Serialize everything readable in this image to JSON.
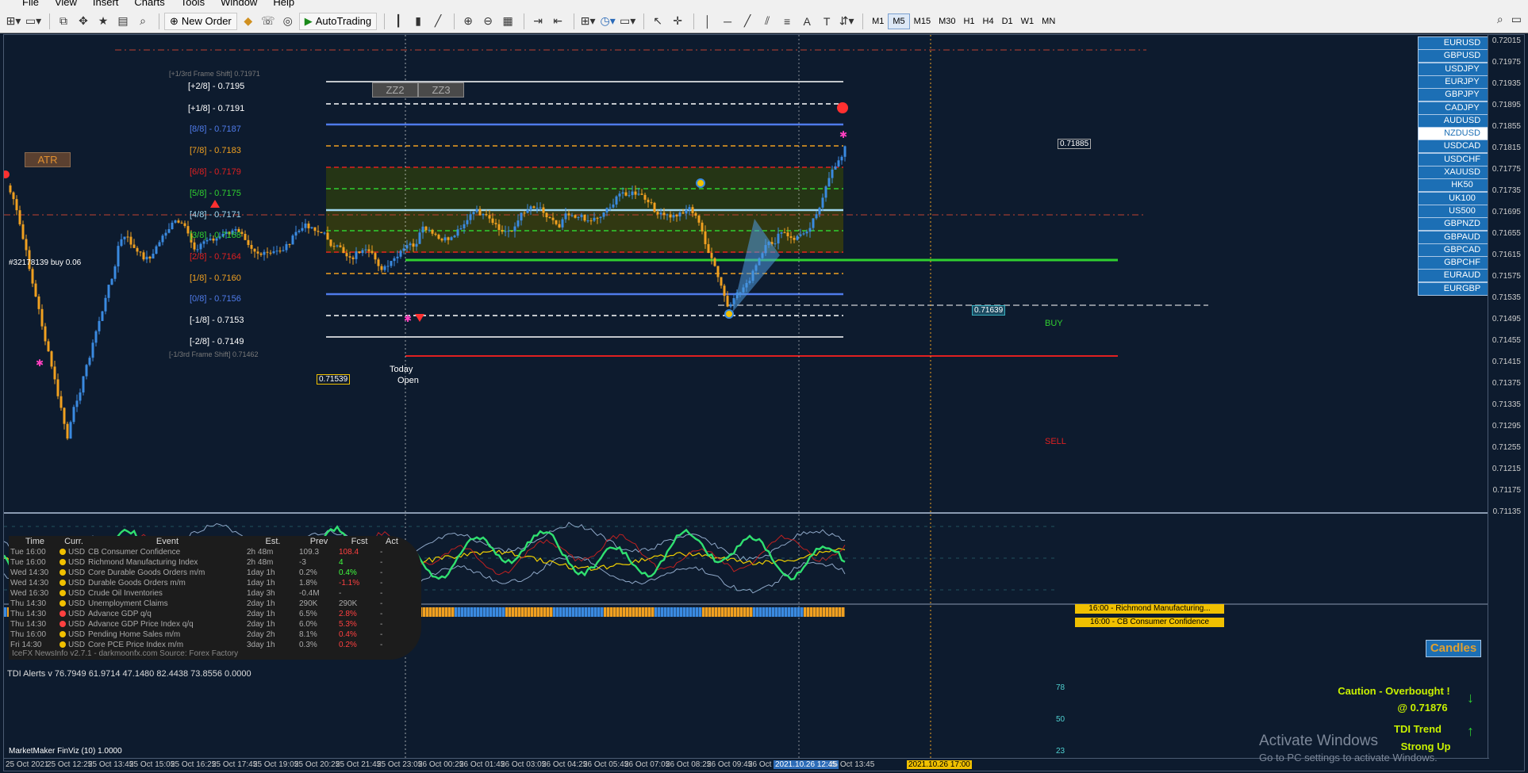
{
  "menu": [
    "File",
    "View",
    "Insert",
    "Charts",
    "Tools",
    "Window",
    "Help"
  ],
  "toolbar": {
    "new_order": "New Order",
    "auto_trading": "AutoTrading",
    "timeframes": [
      "M1",
      "M5",
      "M15",
      "M30",
      "H1",
      "H4",
      "D1",
      "W1",
      "MN"
    ],
    "active_timeframe": "M5"
  },
  "chart": {
    "zz_buttons": [
      "ZZ2",
      "ZZ3"
    ],
    "atr_button": "ATR",
    "murray_levels": [
      {
        "label": "[+1/3rd Frame Shift]  0.71971",
        "color": "#7a7a7a"
      },
      {
        "label": "[+2/8] - 0.7195",
        "color": "#ffffff"
      },
      {
        "label": "[+1/8] - 0.7191",
        "color": "#ffffff"
      },
      {
        "label": "[8/8] - 0.7187",
        "color": "#4f7bea"
      },
      {
        "label": "[7/8] - 0.7183",
        "color": "#f0a020"
      },
      {
        "label": "[6/8] - 0.7179",
        "color": "#e02020"
      },
      {
        "label": "[5/8] - 0.7175",
        "color": "#30d030"
      },
      {
        "label": "[4/8] - 0.7171",
        "color": "#a0d8f0"
      },
      {
        "label": "[3/8] - 0.7168",
        "color": "#30d030"
      },
      {
        "label": "[2/8] - 0.7164",
        "color": "#e02020"
      },
      {
        "label": "[1/8] - 0.7160",
        "color": "#f0a020"
      },
      {
        "label": "[0/8] - 0.7156",
        "color": "#4f7bea"
      },
      {
        "label": "[-1/8] - 0.7153",
        "color": "#ffffff"
      },
      {
        "label": "[-2/8] - 0.7149",
        "color": "#ffffff"
      },
      {
        "label": "[-1/3rd Frame Shift]  0.71462",
        "color": "#7a7a7a"
      }
    ],
    "order_label": "#32178139 buy 0.06",
    "today_open": {
      "today": "Today",
      "open": "Open"
    },
    "price_tag_left": "0.71539",
    "price_tag_current": "0.71885",
    "price_tag_mid": "0.71639",
    "buy_label": "BUY",
    "sell_label": "SELL"
  },
  "symbols": [
    "EURUSD",
    "GBPUSD",
    "USDJPY",
    "EURJPY",
    "GBPJPY",
    "CADJPY",
    "AUDUSD",
    "NZDUSD",
    "USDCAD",
    "USDCHF",
    "XAUUSD",
    "HK50",
    "UK100",
    "US500",
    "GBPNZD",
    "GBPAUD",
    "GBPCAD",
    "GBPCHF",
    "EURAUD",
    "EURGBP"
  ],
  "selected_symbol": "NZDUSD",
  "price_scale": [
    "0.72015",
    "0.71975",
    "0.71935",
    "0.71895",
    "0.71855",
    "0.71815",
    "0.71775",
    "0.71735",
    "0.71695",
    "0.71655",
    "0.71615",
    "0.71575",
    "0.71535",
    "0.71495",
    "0.71455",
    "0.71415",
    "0.71375",
    "0.71335",
    "0.71295",
    "0.71255",
    "0.71215",
    "0.71175",
    "0.71135"
  ],
  "news": {
    "headers": [
      "Time",
      "Curr.",
      "Event",
      "Est.",
      "Prev",
      "Fcst",
      "Act"
    ],
    "rows": [
      {
        "time": "Tue  16:00",
        "dot": "#f0c000",
        "curr": "USD",
        "event": "CB Consumer Confidence",
        "est": "2h 48m",
        "prev": "109.3",
        "fcst": "108.4",
        "fcst_color": "#ff4040",
        "act": "-"
      },
      {
        "time": "Tue  16:00",
        "dot": "#f0c000",
        "curr": "USD",
        "event": "Richmond Manufacturing Index",
        "est": "2h 48m",
        "prev": "-3",
        "fcst": "4",
        "fcst_color": "#40ff40",
        "act": "-"
      },
      {
        "time": "Wed  14:30",
        "dot": "#f0c000",
        "curr": "USD",
        "event": "Core Durable Goods Orders m/m",
        "est": "1day 1h",
        "prev": "0.2%",
        "fcst": "0.4%",
        "fcst_color": "#40ff40",
        "act": "-"
      },
      {
        "time": "Wed  14:30",
        "dot": "#f0c000",
        "curr": "USD",
        "event": "Durable Goods Orders m/m",
        "est": "1day 1h",
        "prev": "1.8%",
        "fcst": "-1.1%",
        "fcst_color": "#ff4040",
        "act": "-"
      },
      {
        "time": "Wed  16:30",
        "dot": "#f0c000",
        "curr": "USD",
        "event": "Crude Oil Inventories",
        "est": "1day 3h",
        "prev": "-0.4M",
        "fcst": "-",
        "fcst_color": "#aaaaaa",
        "act": "-"
      },
      {
        "time": "Thu  14:30",
        "dot": "#f0c000",
        "curr": "USD",
        "event": "Unemployment Claims",
        "est": "2day 1h",
        "prev": "290K",
        "fcst": "290K",
        "fcst_color": "#aaaaaa",
        "act": "-"
      },
      {
        "time": "Thu  14:30",
        "dot": "#ff4040",
        "curr": "USD",
        "event": "Advance GDP q/q",
        "est": "2day 1h",
        "prev": "6.5%",
        "fcst": "2.8%",
        "fcst_color": "#ff4040",
        "act": "-"
      },
      {
        "time": "Thu  14:30",
        "dot": "#ff4040",
        "curr": "USD",
        "event": "Advance GDP Price Index q/q",
        "est": "2day 1h",
        "prev": "6.0%",
        "fcst": "5.3%",
        "fcst_color": "#ff4040",
        "act": "-"
      },
      {
        "time": "Thu  16:00",
        "dot": "#f0c000",
        "curr": "USD",
        "event": "Pending Home Sales m/m",
        "est": "2day 2h",
        "prev": "8.1%",
        "fcst": "0.4%",
        "fcst_color": "#ff4040",
        "act": "-"
      },
      {
        "time": "Fri   14:30",
        "dot": "#f0c000",
        "curr": "USD",
        "event": "Core PCE Price Index m/m",
        "est": "3day 1h",
        "prev": "0.3%",
        "fcst": "0.2%",
        "fcst_color": "#ff4040",
        "act": "-"
      }
    ],
    "footer": "IceFX NewsInfo v2.7.1  -  darkmoonfx.com          Source: Forex Factory"
  },
  "news_tags": [
    "16:00 - Richmond Manufacturing...",
    "16:00 - CB Consumer Confidence"
  ],
  "candles_button": "Candles",
  "tdi": {
    "title": "TDI Alerts v  76.7949 61.9714 47.1480 82.4438 73.8556 0.0000",
    "levels": [
      "78",
      "50",
      "23"
    ],
    "caution": "Caution - Overbought !",
    "caution_price": "@ 0.71876",
    "trend_title": "TDI Trend",
    "trend_value": "Strong Up"
  },
  "bottom_indicator": "MarketMaker FinViz (10) 1.0000",
  "time_axis": [
    "25 Oct 2021",
    "25 Oct 12:25",
    "25 Oct 13:45",
    "25 Oct 15:05",
    "25 Oct 16:25",
    "25 Oct 17:45",
    "25 Oct 19:05",
    "25 Oct 20:25",
    "25 Oct 21:45",
    "25 Oct 23:05",
    "26 Oct 00:25",
    "26 Oct 01:45",
    "26 Oct 03:05",
    "26 Oct 04:25",
    "26 Oct 05:45",
    "26 Oct 07:05",
    "26 Oct 08:25",
    "26 Oct 09:45",
    "26 Oct 11",
    "2021.10.26 12:45",
    "26 Oct 13:45",
    "2021.10.26 17:00"
  ],
  "watermark": {
    "line1": "Activate Windows",
    "line2": "Go to PC settings to activate Windows."
  }
}
